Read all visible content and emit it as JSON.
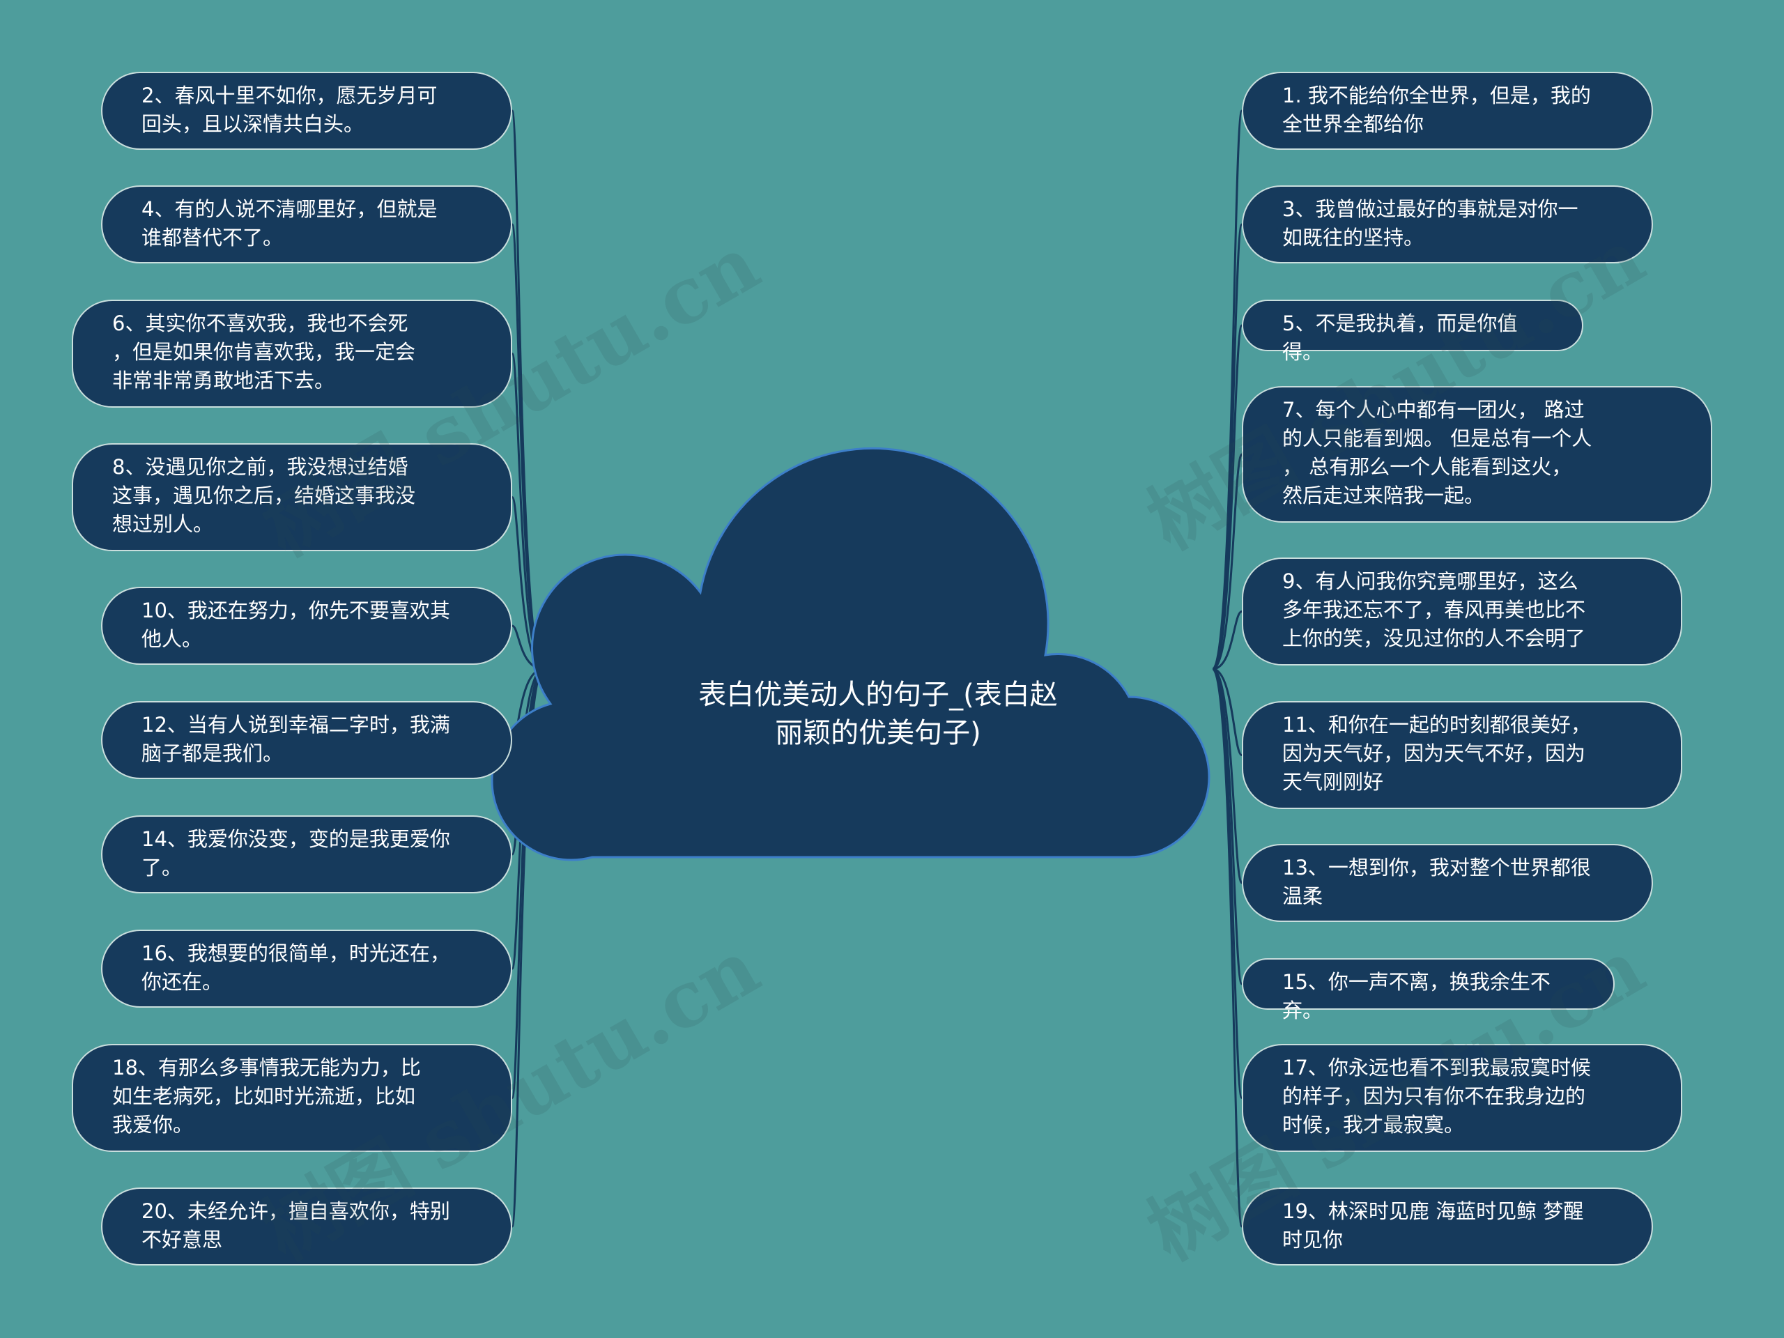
{
  "central_topic": "表白优美动人的句子_(表白赵丽颖的优美句子)",
  "colors": {
    "background": "#4e9d9c",
    "node_fill": "#163a5c",
    "node_border": "#c9dedd",
    "connector": "#163a5c",
    "cloud_border": "#3d7fc9"
  },
  "left_items": [
    {
      "text": "2、春风十里不如你，愿无岁月可\n回头，且以深情共白头。"
    },
    {
      "text": "4、有的人说不清哪里好，但就是\n谁都替代不了。"
    },
    {
      "text": "6、其实你不喜欢我，我也不会死\n，但是如果你肯喜欢我，我一定会\n非常非常勇敢地活下去。"
    },
    {
      "text": "8、没遇见你之前，我没想过结婚\n这事，遇见你之后，结婚这事我没\n想过别人。"
    },
    {
      "text": "10、我还在努力，你先不要喜欢其\n他人。"
    },
    {
      "text": "12、当有人说到幸福二字时，我满\n脑子都是我们。"
    },
    {
      "text": "14、我爱你没变，变的是我更爱你\n了。"
    },
    {
      "text": "16、我想要的很简单，时光还在，\n你还在。"
    },
    {
      "text": "18、有那么多事情我无能为力，比\n如生老病死，比如时光流逝，比如\n我爱你。"
    },
    {
      "text": "20、未经允许，擅自喜欢你，特别\n不好意思"
    }
  ],
  "right_items": [
    {
      "text": "1. 我不能给你全世界，但是，我的\n全世界全都给你"
    },
    {
      "text": "3、我曾做过最好的事就是对你一\n如既往的坚持。"
    },
    {
      "text": "5、不是我执着，而是你值得。"
    },
    {
      "text": "7、每个人心中都有一团火， 路过\n的人只能看到烟。 但是总有一个人\n， 总有那么一个人能看到这火，\n然后走过来陪我一起。"
    },
    {
      "text": "9、有人问我你究竟哪里好，这么\n多年我还忘不了，春风再美也比不\n上你的笑，没见过你的人不会明了"
    },
    {
      "text": "11、和你在一起的时刻都很美好，\n因为天气好，因为天气不好，因为\n天气刚刚好"
    },
    {
      "text": "13、一想到你，我对整个世界都很\n温柔"
    },
    {
      "text": "15、你一声不离，换我余生不弃。"
    },
    {
      "text": "17、你永远也看不到我最寂寞时候\n的样子，因为只有你不在我身边的\n时候，我才最寂寞。"
    },
    {
      "text": "19、林深时见鹿 海蓝时见鲸 梦醒\n时见你"
    }
  ],
  "watermark": "树图 shutu.cn"
}
